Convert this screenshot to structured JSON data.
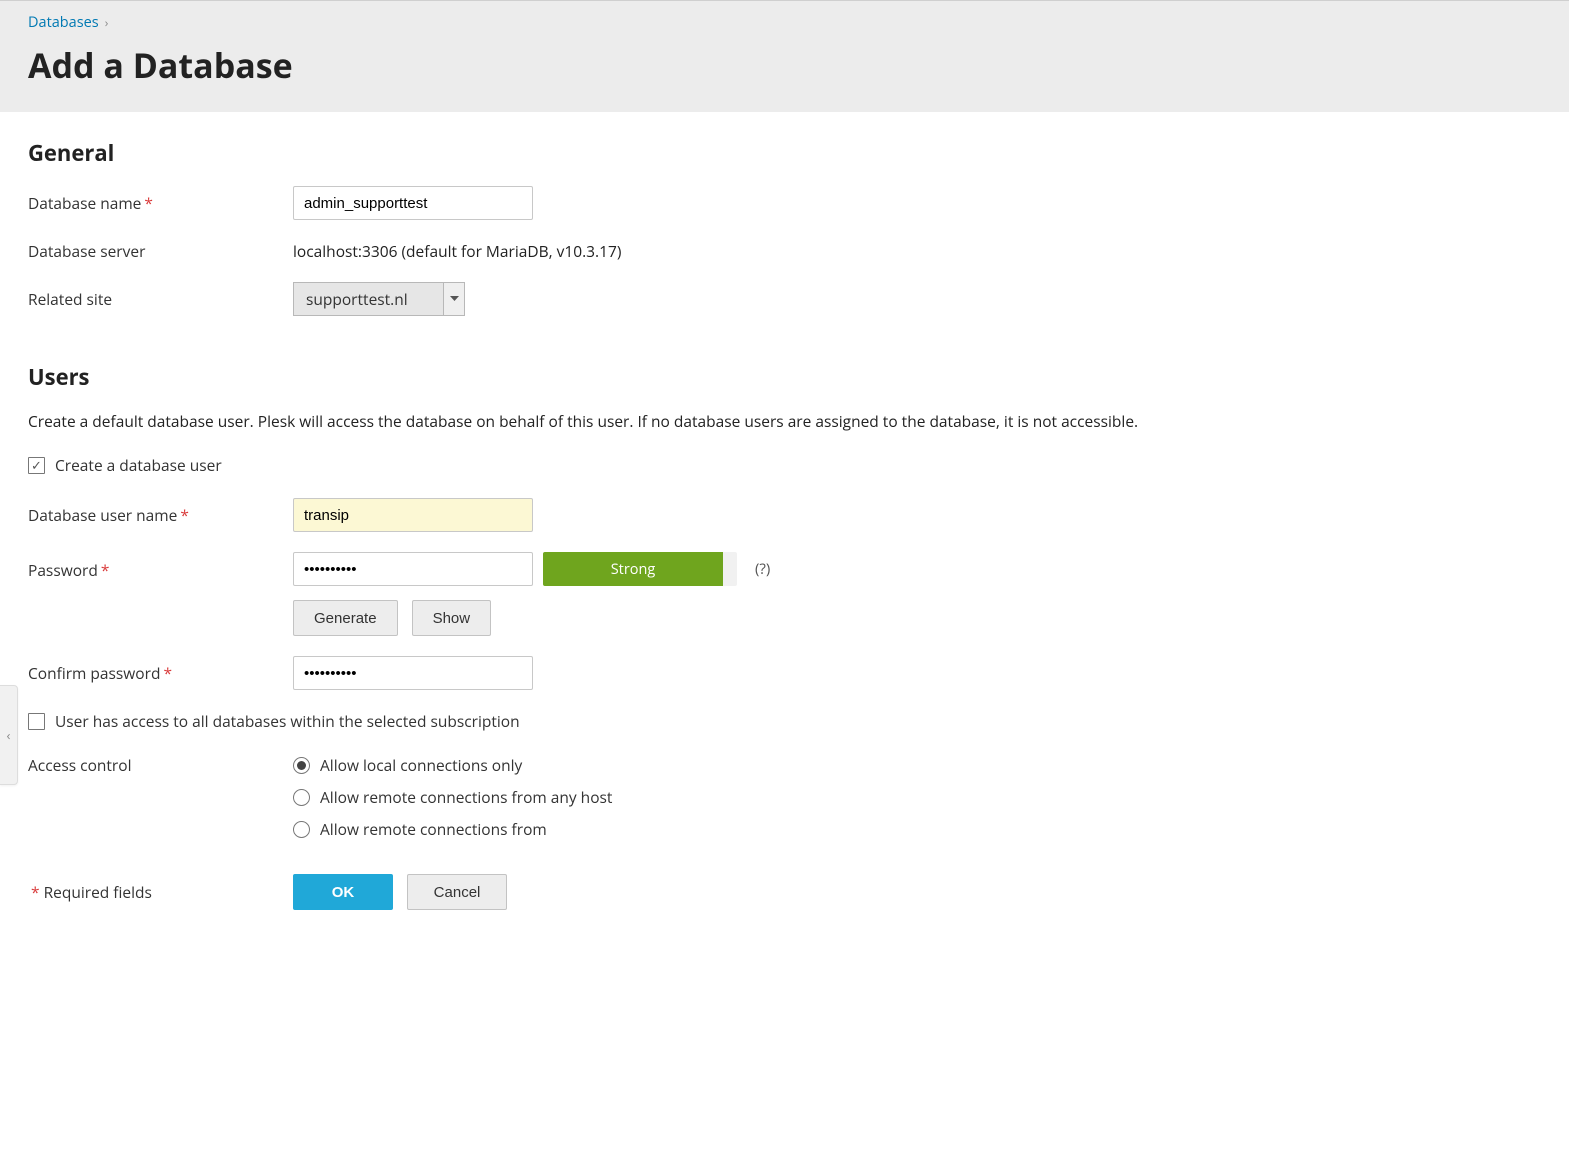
{
  "breadcrumb": {
    "link": "Databases"
  },
  "page_title": "Add a Database",
  "sections": {
    "general": {
      "heading": "General",
      "db_name_label": "Database name",
      "db_name_value": "admin_supporttest",
      "db_server_label": "Database server",
      "db_server_value": "localhost:3306 (default for MariaDB, v10.3.17)",
      "related_site_label": "Related site",
      "related_site_value": "supporttest.nl"
    },
    "users": {
      "heading": "Users",
      "description": "Create a default database user. Plesk will access the database on behalf of this user. If no database users are assigned to the database, it is not accessible.",
      "create_user_checkbox": {
        "label": "Create a database user",
        "checked": true
      },
      "user_name_label": "Database user name",
      "user_name_value": "transip",
      "password_label": "Password",
      "password_value": "●●●●●●●●●●",
      "strength_label": "Strong",
      "help_hint": "(?)",
      "generate_btn": "Generate",
      "show_btn": "Show",
      "confirm_label": "Confirm password",
      "confirm_value": "●●●●●●●●●●",
      "all_db_checkbox": {
        "label": "User has access to all databases within the selected subscription",
        "checked": false
      },
      "access_control_label": "Access control",
      "access_options": [
        {
          "label": "Allow local connections only",
          "selected": true
        },
        {
          "label": "Allow remote connections from any host",
          "selected": false
        },
        {
          "label": "Allow remote connections from",
          "selected": false
        }
      ]
    }
  },
  "footer": {
    "required_note_prefix": "*",
    "required_note": " Required fields",
    "ok": "OK",
    "cancel": "Cancel"
  }
}
